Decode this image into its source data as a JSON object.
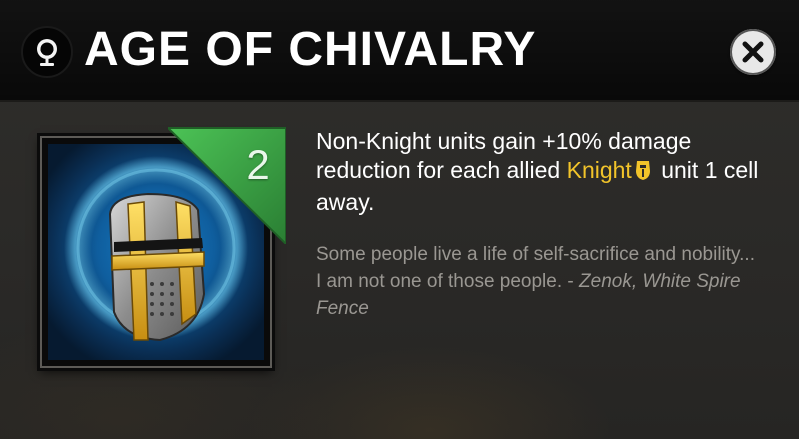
{
  "header": {
    "title": "AGE OF CHIVALRY",
    "globe_icon": "globe-icon",
    "close_icon": "close-icon"
  },
  "ability": {
    "icon": "knight-helmet-icon",
    "level": "2",
    "badge_color": "#3aa345",
    "description": {
      "before": "Non-Knight units gain +10% damage reduction for each allied",
      "keyword": "Knight",
      "keyword_icon": "knight-alliance-icon",
      "after": "unit 1 cell away."
    },
    "lore": {
      "quote": "Some people live a life of self-sacrifice and nobility... I am not one of those people. -",
      "author": "Zenok, White Spire Fence"
    }
  },
  "colors": {
    "keyword": "#f2c42a",
    "lore_text": "#9a9792",
    "title_bar": "#090909"
  }
}
